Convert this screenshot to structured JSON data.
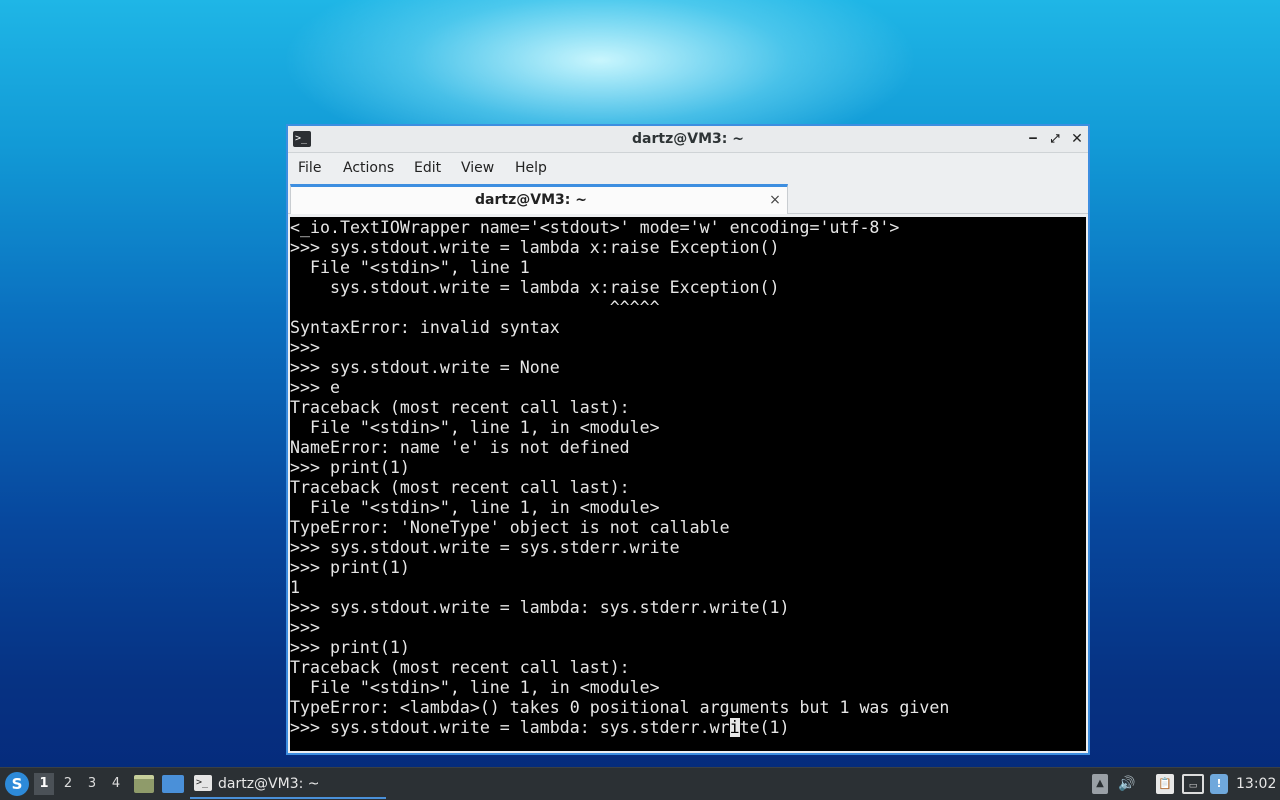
{
  "window": {
    "title": "dartz@VM3: ~",
    "app_icon": ">_",
    "controls": {
      "minimize": "‒",
      "maximize": "⤢",
      "close": "✕"
    }
  },
  "menubar": {
    "file": "File",
    "actions": "Actions",
    "edit": "Edit",
    "view": "View",
    "help": "Help"
  },
  "tab": {
    "label": "dartz@VM3: ~",
    "close": "×"
  },
  "terminal": {
    "lines": [
      "<_io.TextIOWrapper name='<stdout>' mode='w' encoding='utf-8'>",
      ">>> sys.stdout.write = lambda x:raise Exception()",
      "  File \"<stdin>\", line 1",
      "    sys.stdout.write = lambda x:raise Exception()",
      "                                ^^^^^",
      "SyntaxError: invalid syntax",
      ">>>",
      ">>> sys.stdout.write = None",
      ">>> e",
      "Traceback (most recent call last):",
      "  File \"<stdin>\", line 1, in <module>",
      "NameError: name 'e' is not defined",
      ">>> print(1)",
      "Traceback (most recent call last):",
      "  File \"<stdin>\", line 1, in <module>",
      "TypeError: 'NoneType' object is not callable",
      ">>> sys.stdout.write = sys.stderr.write",
      ">>> print(1)",
      "1",
      ">>> sys.stdout.write = lambda: sys.stderr.write(1)",
      ">>>",
      ">>> print(1)",
      "Traceback (most recent call last):",
      "  File \"<stdin>\", line 1, in <module>",
      "TypeError: <lambda>() takes 0 positional arguments but 1 was given"
    ],
    "last_line_before": ">>> sys.stdout.write = lambda: sys.stderr.wr",
    "last_line_cursor": "i",
    "last_line_after": "te(1)"
  },
  "taskbar": {
    "start_icon": "S",
    "workspaces": [
      "1",
      "2",
      "3",
      "4"
    ],
    "task_label": "dartz@VM3: ~",
    "task_icon": ">_",
    "tray": {
      "eject": "▲",
      "volume": "🔊",
      "clipboard": "📋",
      "network": "▭",
      "update": "!"
    },
    "clock": "13:02"
  }
}
